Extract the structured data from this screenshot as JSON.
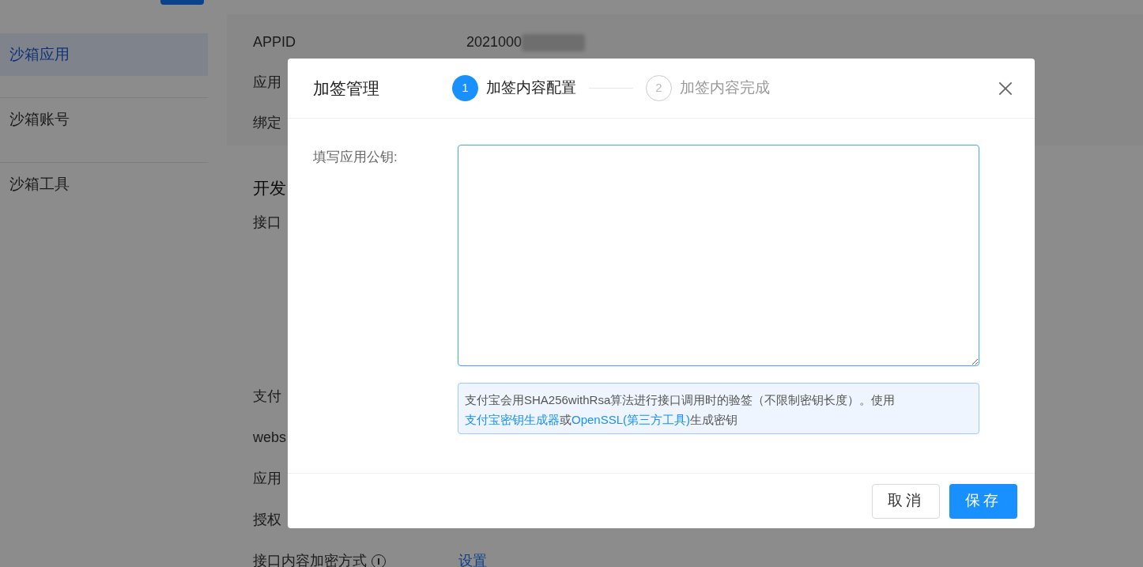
{
  "sidebar": {
    "items": [
      {
        "label": "沙箱应用",
        "selected": true
      },
      {
        "label": "沙箱账号",
        "selected": false
      },
      {
        "label": "沙箱工具",
        "selected": false
      }
    ]
  },
  "app_info": [
    {
      "label": "APPID",
      "value": "2021000",
      "redacted": true
    },
    {
      "label": "应用"
    },
    {
      "label": "绑定"
    }
  ],
  "section_title": "开发",
  "settings": [
    {
      "label": "接口",
      "tall": true
    },
    {
      "label": "支付"
    },
    {
      "label": "webs"
    },
    {
      "label": "应用"
    },
    {
      "label": "授权"
    },
    {
      "label": "接口内容加密方式",
      "info": true,
      "action": "设置"
    }
  ],
  "dialog": {
    "title": "加签管理",
    "steps": [
      {
        "number": "1",
        "label": "加签内容配置",
        "selected": true
      },
      {
        "number": "2",
        "label": "加签内容完成",
        "selected": false
      }
    ],
    "field_label": "填写应用公钥:",
    "hint": [
      {
        "text": "支付宝会用SHA256withRsa算法进行接口调用时的验签（不限制密钥长度）。使用",
        "kind": "text"
      },
      {
        "text": "支付宝密钥生成器",
        "kind": "link"
      },
      {
        "text": "或",
        "kind": "text"
      },
      {
        "text": "OpenSSL(第三方工具)",
        "kind": "link"
      },
      {
        "text": "生成密钥",
        "kind": "text"
      }
    ],
    "buttons": [
      {
        "label": "取消",
        "kind": "secondary"
      },
      {
        "label": "保存",
        "kind": "primary"
      }
    ]
  }
}
